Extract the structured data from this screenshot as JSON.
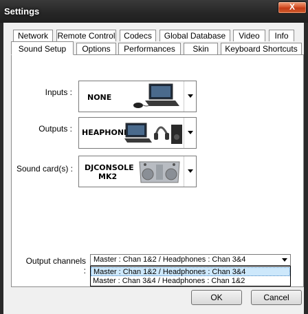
{
  "window": {
    "title": "Settings",
    "close_glyph": "X"
  },
  "tabs_row1": [
    "Network",
    "Remote Control",
    "Codecs",
    "Global Database",
    "Video",
    "Info"
  ],
  "tabs_row2": [
    "Sound Setup",
    "Options",
    "Performances",
    "Skin",
    "Keyboard Shortcuts"
  ],
  "active_tab": "Sound Setup",
  "inputs": {
    "label": "Inputs :",
    "value": "NONE"
  },
  "outputs": {
    "label": "Outputs :",
    "value": "HEAPHONES"
  },
  "soundcard": {
    "label": "Sound card(s) :",
    "value_line1": "DJCONSOLE",
    "value_line2": "MK2"
  },
  "output_channels": {
    "label": "Output channels :",
    "selected": "Master : Chan 1&2 / Headphones : Chan 3&4",
    "options": [
      "Master : Chan 1&2 / Headphones : Chan 3&4",
      "Master : Chan 3&4 / Headphones : Chan 1&2"
    ]
  },
  "buttons": {
    "ok": "OK",
    "cancel": "Cancel"
  }
}
